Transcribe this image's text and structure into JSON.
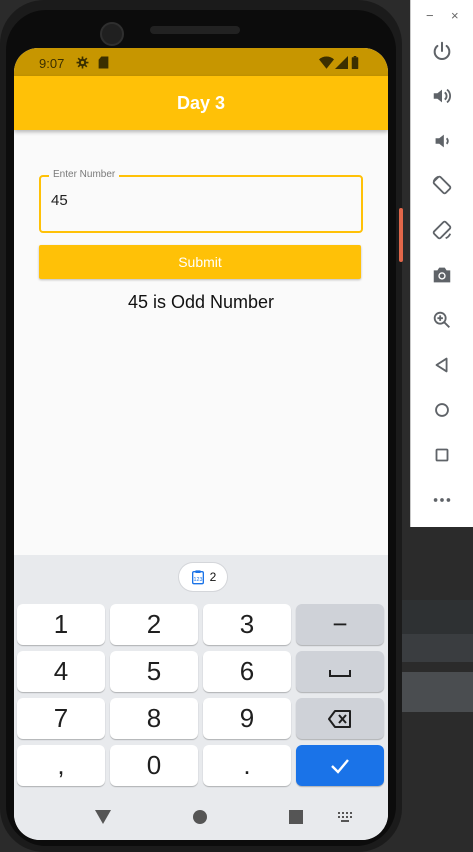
{
  "status_bar": {
    "time": "9:07",
    "icons": [
      "gear-icon",
      "sd-card-icon",
      "wifi-icon",
      "cell-signal-icon",
      "battery-icon"
    ]
  },
  "app_bar": {
    "title": "Day 3",
    "color": "#ffc107"
  },
  "form": {
    "field_label": "Enter Number",
    "field_value": "45",
    "submit_label": "Submit",
    "result_text": "45 is Odd Number"
  },
  "keyboard": {
    "clipboard_count": "2",
    "rows": [
      [
        "1",
        "2",
        "3",
        "−"
      ],
      [
        "4",
        "5",
        "6",
        "space-icon"
      ],
      [
        "7",
        "8",
        "9",
        "backspace-icon"
      ],
      [
        ",",
        "0",
        ".",
        "check-icon"
      ]
    ],
    "accent": "#1a73e8"
  },
  "nav_bar": [
    "back-triangle-icon",
    "home-circle-icon",
    "recents-square-icon",
    "keyboard-switch-icon"
  ],
  "emulator_toolbar": {
    "window_controls": [
      "−",
      "×"
    ],
    "buttons": [
      "power-icon",
      "volume-up-icon",
      "volume-down-icon",
      "rotate-left-icon",
      "rotate-right-icon",
      "camera-icon",
      "zoom-icon",
      "back-icon",
      "home-icon",
      "overview-icon",
      "more-icon"
    ]
  }
}
